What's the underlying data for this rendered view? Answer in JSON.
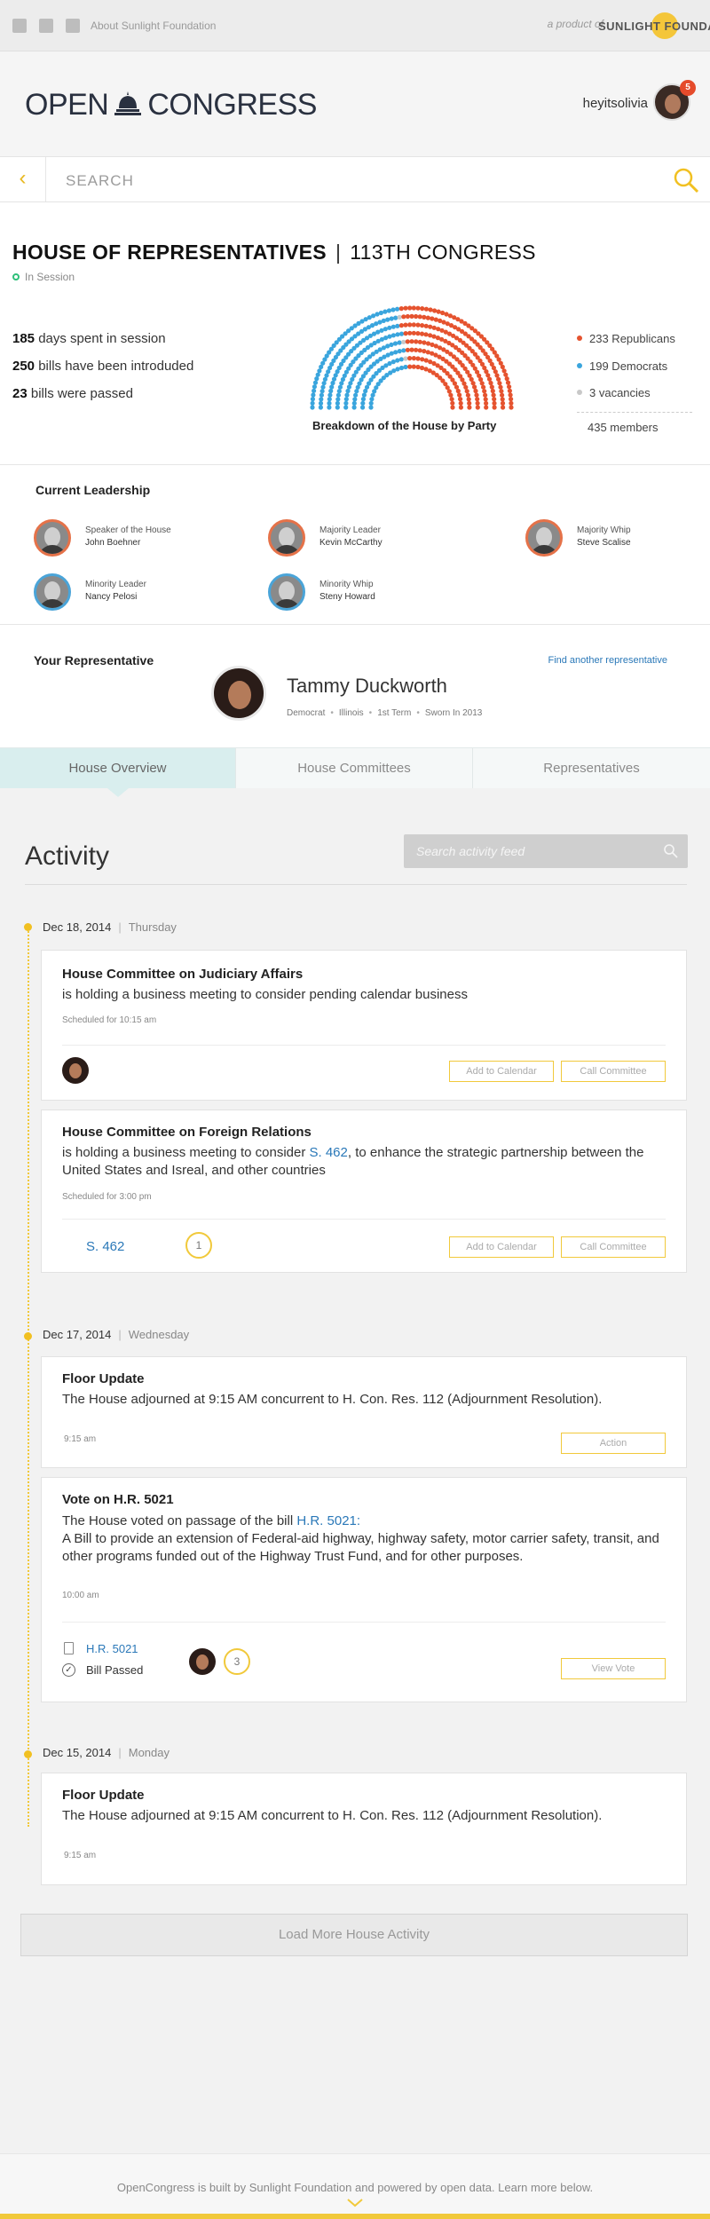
{
  "topbar": {
    "about_link": "About Sunlight Foundation",
    "product_of": "a product of",
    "sunlight_brand": "SUNLIGHT FOUNDATION"
  },
  "header": {
    "logo_left": "OPEN",
    "logo_right": "CONGRESS",
    "username": "heyitsolivia",
    "notification_count": "5"
  },
  "search": {
    "placeholder": "SEARCH"
  },
  "house": {
    "title": "HOUSE OF REPRESENTATIVES",
    "separator": "|",
    "congress": "113TH CONGRESS",
    "status": "In Session",
    "stats": [
      {
        "num": "185",
        "text": "days spent in session"
      },
      {
        "num": "250",
        "text": "bills have been introduded"
      },
      {
        "num": "23",
        "text": "bills were passed"
      }
    ],
    "chart_caption": "Breakdown of the House by Party",
    "legend": [
      {
        "label": "233 Republicans",
        "color": "#e5532f"
      },
      {
        "label": "199 Democrats",
        "color": "#3aa5dd"
      },
      {
        "label": "3 vacancies",
        "color": "#c8c8c8"
      }
    ],
    "members": "435 members"
  },
  "chart_data": {
    "type": "hemicycle",
    "series": [
      {
        "name": "Republicans",
        "value": 233,
        "color": "#e5532f"
      },
      {
        "name": "Democrats",
        "value": 199,
        "color": "#3aa5dd"
      },
      {
        "name": "vacancies",
        "value": 3,
        "color": "#c8c8c8"
      }
    ],
    "total": 435,
    "title": "Breakdown of the House by Party"
  },
  "leadership": {
    "heading": "Current Leadership",
    "leaders": [
      {
        "role": "Speaker of the House",
        "name": "John Boehner"
      },
      {
        "role": "Majority Leader",
        "name": "Kevin McCarthy"
      },
      {
        "role": "Majority Whip",
        "name": "Steve Scalise"
      },
      {
        "role": "Minority Leader",
        "name": "Nancy Pelosi"
      },
      {
        "role": "Minority Whip",
        "name": "Steny Howard"
      }
    ]
  },
  "rep": {
    "heading": "Your Representative",
    "find_link": "Find another representative",
    "name": "Tammy Duckworth",
    "party": "Democrat",
    "state": "Illinois",
    "term": "1st Term",
    "sworn": "Sworn In 2013"
  },
  "tabs": [
    {
      "label": "House Overview"
    },
    {
      "label": "House Committees"
    },
    {
      "label": "Representatives"
    }
  ],
  "activity": {
    "title": "Activity",
    "search_placeholder": "Search activity feed",
    "load_more": "Load More House Activity",
    "days": [
      {
        "date": "Dec 18, 2014",
        "dow": "Thursday"
      },
      {
        "date": "Dec 17, 2014",
        "dow": "Wednesday"
      },
      {
        "date": "Dec 15, 2014",
        "dow": "Monday"
      }
    ],
    "cards": {
      "judiciary": {
        "title": "House Committee on Judiciary Affairs",
        "body": "is holding a business meeting to consider pending calendar business",
        "sched": "Scheduled for 10:15 am",
        "btn_calendar": "Add to Calendar",
        "btn_call": "Call Committee"
      },
      "foreign": {
        "title": "House Committee on Foreign Relations",
        "body_pre": "is holding a business meeting to consider ",
        "bill": "S. 462",
        "body_post": ", to enhance the strategic partnership between the United States and Isreal, and other countries",
        "sched": "Scheduled for 3:00 pm",
        "bill_link": "S. 462",
        "count": "1",
        "btn_calendar": "Add to Calendar",
        "btn_call": "Call Committee"
      },
      "floor1": {
        "title": "Floor Update",
        "body": "The House adjourned at 9:15 AM concurrent to H. Con. Res. 112 (Adjournment Resolution).",
        "time": "9:15 am",
        "btn_action": "Action"
      },
      "vote": {
        "title": "Vote on H.R. 5021",
        "body_pre": "The House voted on passage of the bill ",
        "bill": "H.R. 5021:",
        "body_line2": "A Bill to provide an extension of Federal-aid highway, highway safety, motor carrier safety, transit, and other programs funded out of the Highway Trust Fund, and for other purposes.",
        "time": "10:00 am",
        "bill_link": "H.R. 5021",
        "status": "Bill Passed",
        "count": "3",
        "btn_view": "View Vote"
      },
      "floor2": {
        "title": "Floor Update",
        "body": "The House adjourned at 9:15 AM concurrent to H. Con. Res. 112 (Adjournment Resolution).",
        "time": "9:15 am"
      }
    }
  },
  "footer": {
    "text": "OpenCongress is built by Sunlight Foundation and powered by open data. Learn more below."
  }
}
